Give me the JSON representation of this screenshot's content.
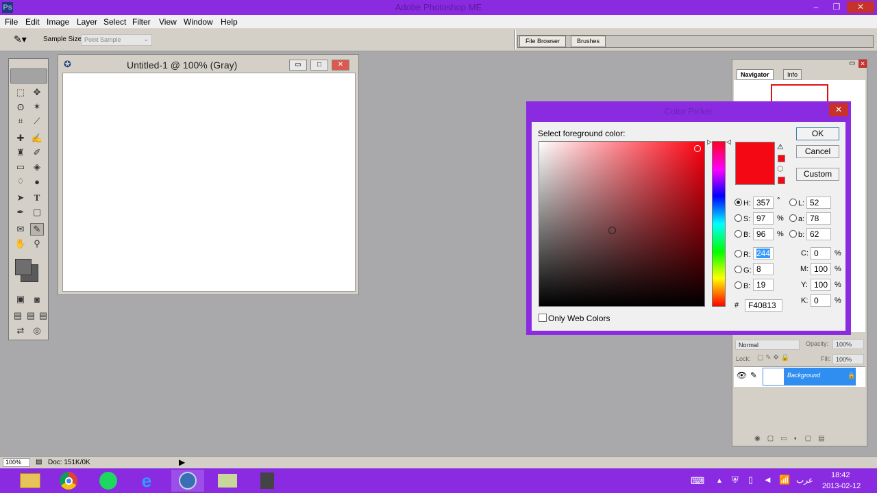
{
  "app": {
    "title": "Adobe Photoshop ME"
  },
  "menu": [
    "File",
    "Edit",
    "Image",
    "Layer",
    "Select",
    "Filter",
    "View",
    "Window",
    "Help"
  ],
  "options": {
    "sample_size_label": "Sample Size:",
    "sample_size_value": "Point Sample"
  },
  "well_tabs": [
    "File Browser",
    "Brushes"
  ],
  "document": {
    "title": "Untitled-1 @ 100% (Gray)"
  },
  "palettes": {
    "tabs": [
      "Navigator",
      "Info"
    ],
    "layers": {
      "blend_mode": "Normal",
      "opacity_label": "Opacity:",
      "opacity_value": "100%",
      "lock_label": "Lock:",
      "fill_label": "Fill:",
      "fill_value": "100%",
      "layer_name": "Background"
    }
  },
  "color_picker": {
    "title": "Color Picker",
    "prompt": "Select foreground color:",
    "buttons": {
      "ok": "OK",
      "cancel": "Cancel",
      "custom": "Custom"
    },
    "current_color": "#F40813",
    "hsb": {
      "h_label": "H:",
      "h": "357",
      "h_unit": "°",
      "s_label": "S:",
      "s": "97",
      "s_unit": "%",
      "b_label": "B:",
      "b": "96",
      "b_unit": "%"
    },
    "lab": {
      "l_label": "L:",
      "l": "52",
      "a_label": "a:",
      "a": "78",
      "b_label": "b:",
      "b": "62"
    },
    "rgb": {
      "r_label": "R:",
      "r": "244",
      "g_label": "G:",
      "g": "8",
      "b_label": "B:",
      "b": "19"
    },
    "cmyk": {
      "c_label": "C:",
      "c": "0",
      "m_label": "M:",
      "m": "100",
      "y_label": "Y:",
      "y": "100",
      "k_label": "K:",
      "k": "0",
      "unit": "%"
    },
    "hex_label": "#",
    "hex": "F40813",
    "web_only_label": "Only Web Colors"
  },
  "status": {
    "zoom": "100%",
    "doc": "Doc: 151K/0K"
  },
  "taskbar": {
    "lang": "عرب",
    "time": "18:42",
    "date": "2013-02-12"
  }
}
